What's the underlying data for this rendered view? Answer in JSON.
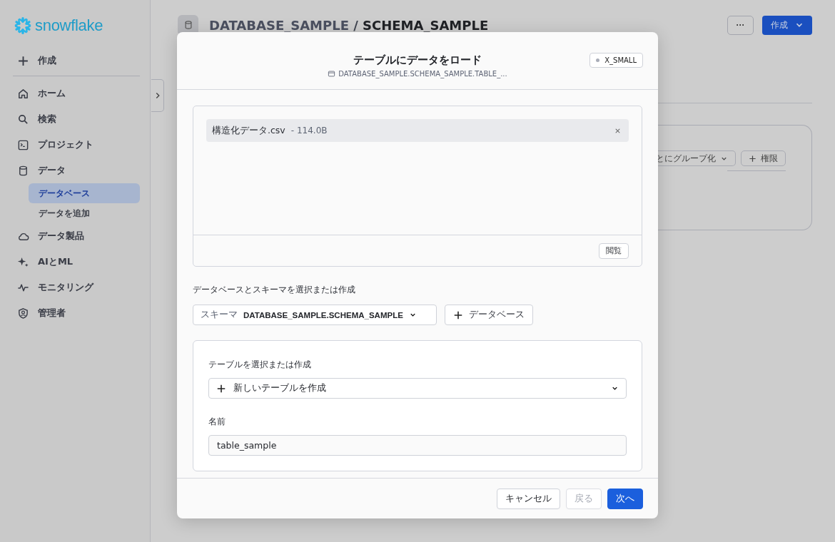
{
  "sidebar": {
    "logo": "snowflake",
    "create": "作成",
    "items": [
      {
        "label": "ホーム",
        "selected": false
      },
      {
        "label": "検索",
        "selected": false
      },
      {
        "label": "プロジェクト",
        "selected": false
      },
      {
        "label": "データ",
        "selected": false,
        "children": [
          {
            "label": "データベース",
            "selected": true
          },
          {
            "label": "データを追加",
            "selected": false
          }
        ]
      },
      {
        "label": "データ製品",
        "selected": false
      },
      {
        "label": "AIとML",
        "selected": false
      },
      {
        "label": "モニタリング",
        "selected": false
      },
      {
        "label": "管理者",
        "selected": false
      }
    ]
  },
  "header": {
    "database": "DATABASE_SAMPLE",
    "separator": "/",
    "schema": "SCHEMA_SAMPLE",
    "more": "···",
    "create": "作成"
  },
  "background_card": {
    "group_by": "とにグループ化",
    "privileges": "権限"
  },
  "dialog": {
    "title": "テーブルにデータをロード",
    "path": "DATABASE_SAMPLE.SCHEMA_SAMPLE.TABLE_...",
    "warehouse": "X_SMALL",
    "file": {
      "name": "構造化データ.csv",
      "size": "- 114.0B"
    },
    "browse": "閲覧",
    "schema_label": "データベースとスキーマを選択または作成",
    "schema_prefix": "スキーマ",
    "schema_value": "DATABASE_SAMPLE.SCHEMA_SAMPLE",
    "add_database": "データベース",
    "table_label": "テーブルを選択または作成",
    "table_value": "新しいテーブルを作成",
    "name_label": "名前",
    "name_value": "table_sample",
    "buttons": [
      {
        "label": "キャンセル",
        "kind": "secondary",
        "disabled": false
      },
      {
        "label": "戻る",
        "kind": "secondary",
        "disabled": true
      },
      {
        "label": "次へ",
        "kind": "primary",
        "disabled": false
      }
    ]
  }
}
